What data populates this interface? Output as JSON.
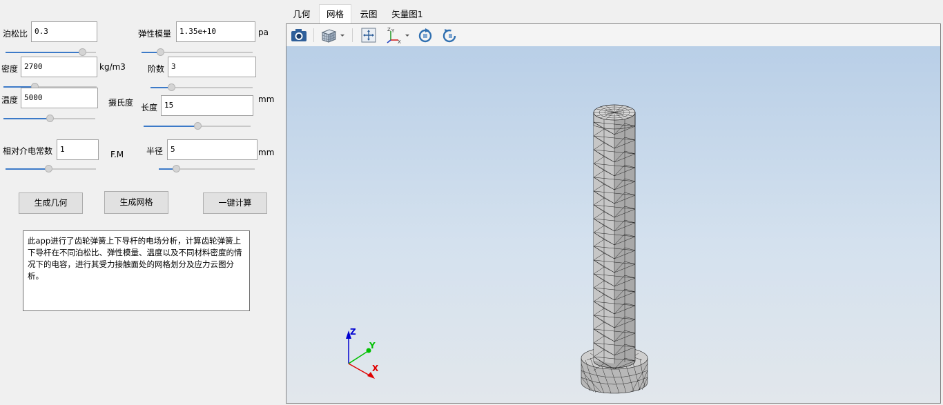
{
  "params": {
    "poisson": {
      "label": "泊松比",
      "value": "0.3",
      "slider": 0.85
    },
    "modulus": {
      "label": "弹性模量",
      "value": "1.35e+10",
      "unit": "pa",
      "slider": 0.17
    },
    "density": {
      "label": "密度",
      "value": "2700",
      "unit": "kg/m3",
      "slider": 0.33
    },
    "order": {
      "label": "阶数",
      "value": "3",
      "slider": 0.2
    },
    "temperature": {
      "label": "温度",
      "value": "5000",
      "slider": 0.5
    },
    "celsius_label": "摄氏度",
    "length": {
      "label": "长度",
      "value": "15",
      "unit": "mm",
      "slider": 0.5
    },
    "permittivity": {
      "label": "相对介电常数",
      "value": "1",
      "slider": 0.47
    },
    "fm_label": "F.M",
    "radius": {
      "label": "半径",
      "value": "5",
      "unit": "mm",
      "slider": 0.18
    }
  },
  "buttons": {
    "geometry": "生成几何",
    "mesh": "生成网格",
    "compute": "一键计算"
  },
  "description": "此app进行了齿轮弹簧上下导杆的电场分析，计算齿轮弹簧上下导杆在不同泊松比、弹性模量、温度以及不同材料密度的情况下的电容，进行其受力接触面处的网格划分及应力云图分析。",
  "tabs": [
    "几何",
    "网格",
    "云图",
    "矢量图1"
  ],
  "active_tab": "网格",
  "toolbar": [
    "camera-icon",
    "view-cube-icon",
    "dropdown-arrow-icon",
    "zoom-extents-icon",
    "axis-orientation-icon",
    "dropdown-arrow-icon",
    "rotate-icon",
    "reset-view-icon"
  ],
  "axes": {
    "x": "X",
    "y": "Y",
    "z": "Z"
  },
  "colors": {
    "accent": "#3c7ac8",
    "bg_top": "#b9cfe7",
    "bg_bottom": "#e2e7ec",
    "axis_x": "#e00000",
    "axis_y": "#00c000",
    "axis_z": "#0000d0"
  }
}
